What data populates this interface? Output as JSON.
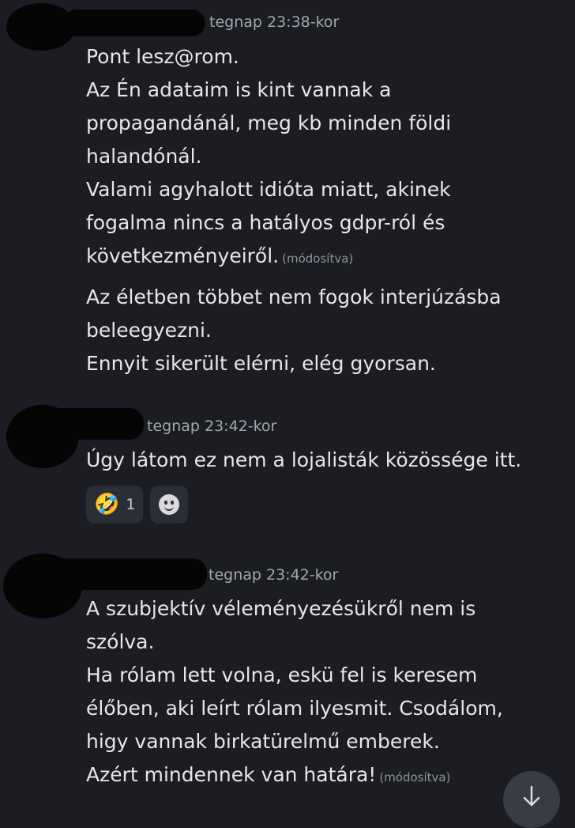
{
  "messages": [
    {
      "timestamp": "tegnap 23:38-kor",
      "lines": [
        "Pont lesz@rom.",
        "Az Én adataim is kint vannak a",
        "propagandánál, meg kb minden földi",
        "halandónál.",
        "Valami agyhalott idióta miatt, akinek",
        "fogalma nincs a hatályos gdpr-ról és",
        "következményeiről."
      ],
      "edited_label": "(módosítva)",
      "followup_lines": [
        "Az életben többet nem fogok interjúzásba",
        "beleegyezni.",
        "Ennyit sikerült elérni, elég gyorsan."
      ]
    },
    {
      "timestamp": "tegnap 23:42-kor",
      "lines": [
        "Úgy látom ez nem a lojalisták közössége itt."
      ],
      "reactions": [
        {
          "emoji": "🤣",
          "icon": "rofl-emoji-icon",
          "count": "1"
        }
      ]
    },
    {
      "timestamp": "tegnap 23:42-kor",
      "lines": [
        "A szubjektív véleményezésükről nem is",
        "szólva.",
        "Ha rólam lett volna, eskü fel is keresem",
        "élőben, aki leírt rólam ilyesmit. Csodálom,",
        "higy vannak birkatürelmű emberek.",
        "Azért mindennek van határa!"
      ],
      "edited_label": "(módosítva)"
    }
  ],
  "icons": {
    "add_reaction": "smiley-icon",
    "scroll_down": "arrow-down-icon"
  },
  "colors": {
    "background": "#1c1d22",
    "text": "#e6e7ea",
    "muted": "#a3a6ad",
    "reaction_bg": "#2c2e35"
  }
}
